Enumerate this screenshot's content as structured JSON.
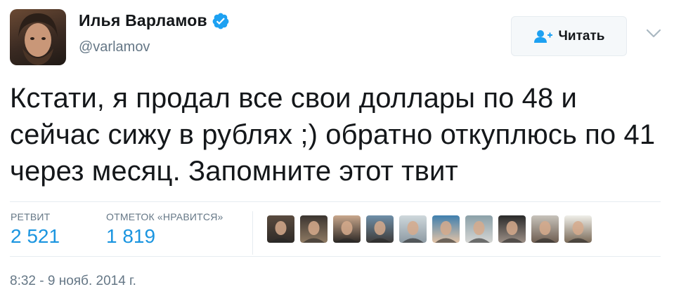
{
  "author": {
    "name": "Илья Варламов",
    "handle": "@varlamov",
    "verified": true,
    "verified_color": "#1da1f2"
  },
  "follow_button": {
    "label": "Читать",
    "icon": "add-user-icon"
  },
  "menu": {
    "icon": "chevron-down-icon"
  },
  "tweet": {
    "text": "Кстати, я продал все свои доллары по 48 и сейчас сижу в рублях ;) обратно откуплюсь по 41 через месяц. Запомните этот твит"
  },
  "stats": {
    "retweets": {
      "label": "РЕТВИТ",
      "value": "2 521"
    },
    "likes": {
      "label": "ОТМЕТОК «НРАВИТСЯ»",
      "value": "1 819"
    }
  },
  "liker_avatars": [
    {
      "colors": [
        "#5a4b3f",
        "#2e2a27"
      ]
    },
    {
      "colors": [
        "#3b3530",
        "#8f7a63"
      ]
    },
    {
      "colors": [
        "#c9a78c",
        "#2b2724"
      ]
    },
    {
      "colors": [
        "#6f8fa8",
        "#3d3a38"
      ]
    },
    {
      "colors": [
        "#cfd8dc",
        "#8d9aa3"
      ]
    },
    {
      "colors": [
        "#3f7fae",
        "#e3c3a6"
      ]
    },
    {
      "colors": [
        "#8aa0a8",
        "#d6d6d4"
      ]
    },
    {
      "colors": [
        "#2a2a2a",
        "#9c8f86"
      ]
    },
    {
      "colors": [
        "#c7c3bb",
        "#6e5d50"
      ]
    },
    {
      "colors": [
        "#efefe9",
        "#7a6a58"
      ]
    }
  ],
  "timestamp": "8:32 - 9 нояб. 2014 г.",
  "colors": {
    "text": "#14171a",
    "secondary": "#657786",
    "accent": "#1b95e0",
    "divider": "#e6ecf0"
  }
}
